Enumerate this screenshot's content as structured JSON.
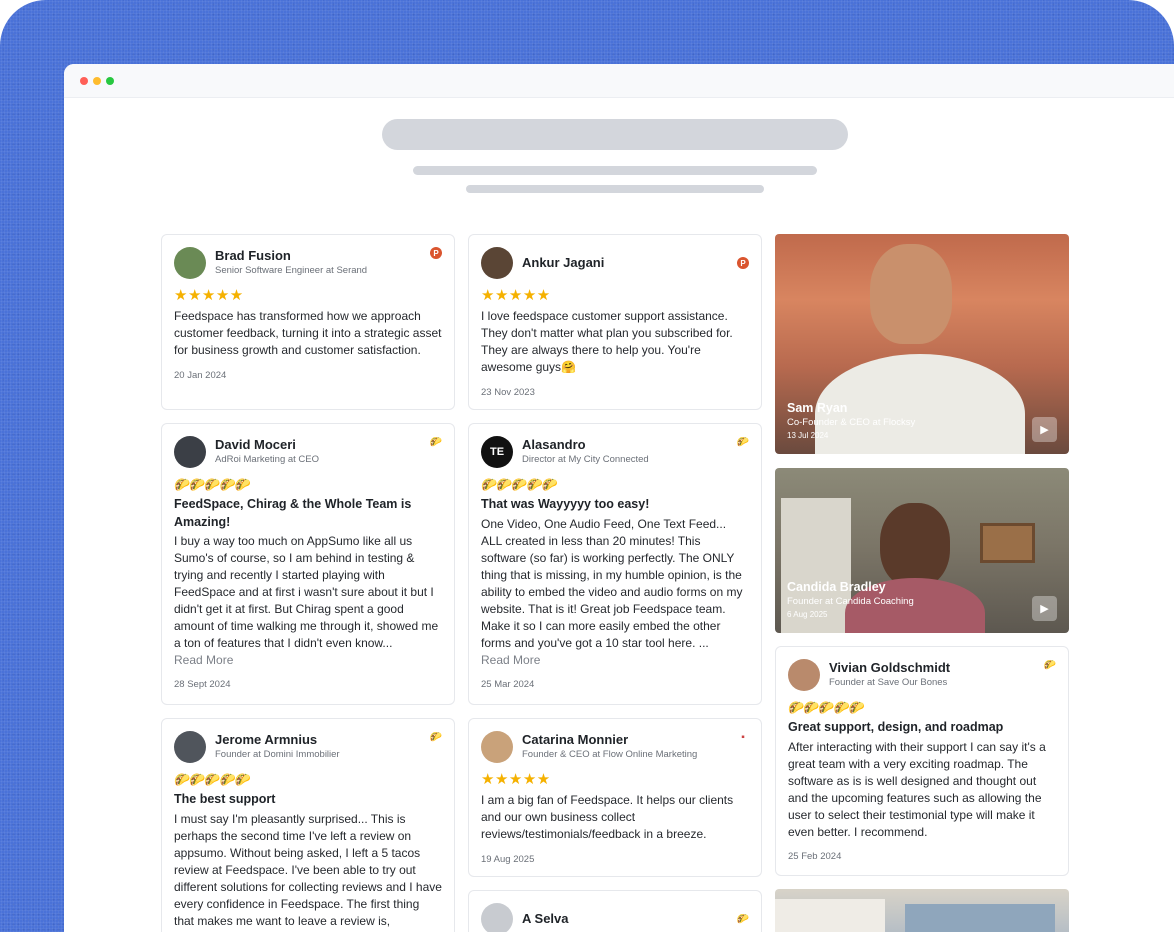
{
  "colors": {
    "background": "#4a72d8",
    "star": "#f5b100",
    "taco": "#f2b400",
    "producthunt": "#da552f"
  },
  "cards": {
    "brad": {
      "name": "Brad Fusion",
      "role": "Senior Software Engineer at Serand",
      "source_icon": "producthunt-icon",
      "rating": 5,
      "text": "Feedspace has transformed how we approach customer feedback, turning it into a strategic asset for business growth and customer satisfaction.",
      "date": "20 Jan 2024"
    },
    "ankur": {
      "name": "Ankur Jagani",
      "role": "",
      "source_icon": "producthunt-icon",
      "rating": 5,
      "text": "I love feedspace customer support assistance. They don't matter what plan you subscribed for. They are always there to help you. You're awesome guys🤗",
      "date": "23 Nov 2023"
    },
    "david": {
      "name": "David Moceri",
      "role": "AdRoi Marketing at CEO",
      "source_icon": "taco-icon",
      "rating": 5,
      "title": "FeedSpace, Chirag & the Whole Team is Amazing!",
      "text": "I buy a way too much on AppSumo like all us Sumo's of course, so I am behind in testing & trying and recently I started playing with FeedSpace and at first i wasn't sure about it but I didn't get it at first. But Chirag spent a good amount of time walking me through it, showed me a ton of features that I didn't even know...",
      "more": "Read More",
      "date": "28 Sept 2024"
    },
    "alasandro": {
      "name": "Alasandro",
      "role": "Director at My City Connected",
      "avatar_text": "TE",
      "source_icon": "taco-icon",
      "rating": 5,
      "title": "That was Wayyyyy too easy!",
      "text": "One Video, One Audio Feed, One Text Feed... ALL created in less than 20 minutes! This software (so far) is working perfectly. The ONLY thing that is missing, in my humble opinion, is the ability to embed the video and audio forms on my website. That is it! Great job Feedspace team. Make it so I can more easily embed the other forms and you've got a 10 star tool here. ...",
      "more": "Read More",
      "date": "25 Mar 2024"
    },
    "jerome": {
      "name": "Jerome Armnius",
      "role": "Founder at Domini Immobilier",
      "source_icon": "taco-icon",
      "rating": 5,
      "title": "The best support",
      "text": "I must say I'm pleasantly surprised... This is perhaps the second time I've left a review on appsumo. Without being asked, I left a 5 tacos review at Feedspace. I've been able to try out different solutions for collecting reviews and I have every confidence in Feedspace. The first thing that makes me want to leave a review is,"
    },
    "catarina": {
      "name": "Catarina Monnier",
      "role": "Founder & CEO at Flow Online Marketing",
      "source_icon": "image-icon",
      "rating": 5,
      "text": "I am a big fan of Feedspace. It helps our clients and our own business collect reviews/testimonials/feedback in a breeze.",
      "date": "19 Aug 2025"
    },
    "selva": {
      "name": "A Selva",
      "source_icon": "taco-icon"
    },
    "vivian": {
      "name": "Vivian Goldschmidt",
      "role": "Founder at Save Our Bones",
      "source_icon": "taco-icon",
      "rating": 5,
      "title": "Great support, design, and roadmap",
      "text": "After interacting with their support I can say it's a great team with a very exciting roadmap. The software as is is well designed and thought out and the upcoming features such as allowing the user to select their testimonial type will make it even better. I recommend.",
      "date": "25 Feb 2024"
    }
  },
  "videos": {
    "sam": {
      "name": "Sam Ryan",
      "role": "Co-Founder & CEO at Flocksy",
      "date": "13 Jul 2024"
    },
    "candida": {
      "name": "Candida Bradley",
      "role": "Founder at Candida Coaching",
      "date": "6 Aug 2025"
    }
  },
  "glyphs": {
    "stars": "★★★★★",
    "tacos": "🌮🌮🌮🌮🌮",
    "taco": "🌮",
    "ph": "P",
    "play": "▶"
  }
}
